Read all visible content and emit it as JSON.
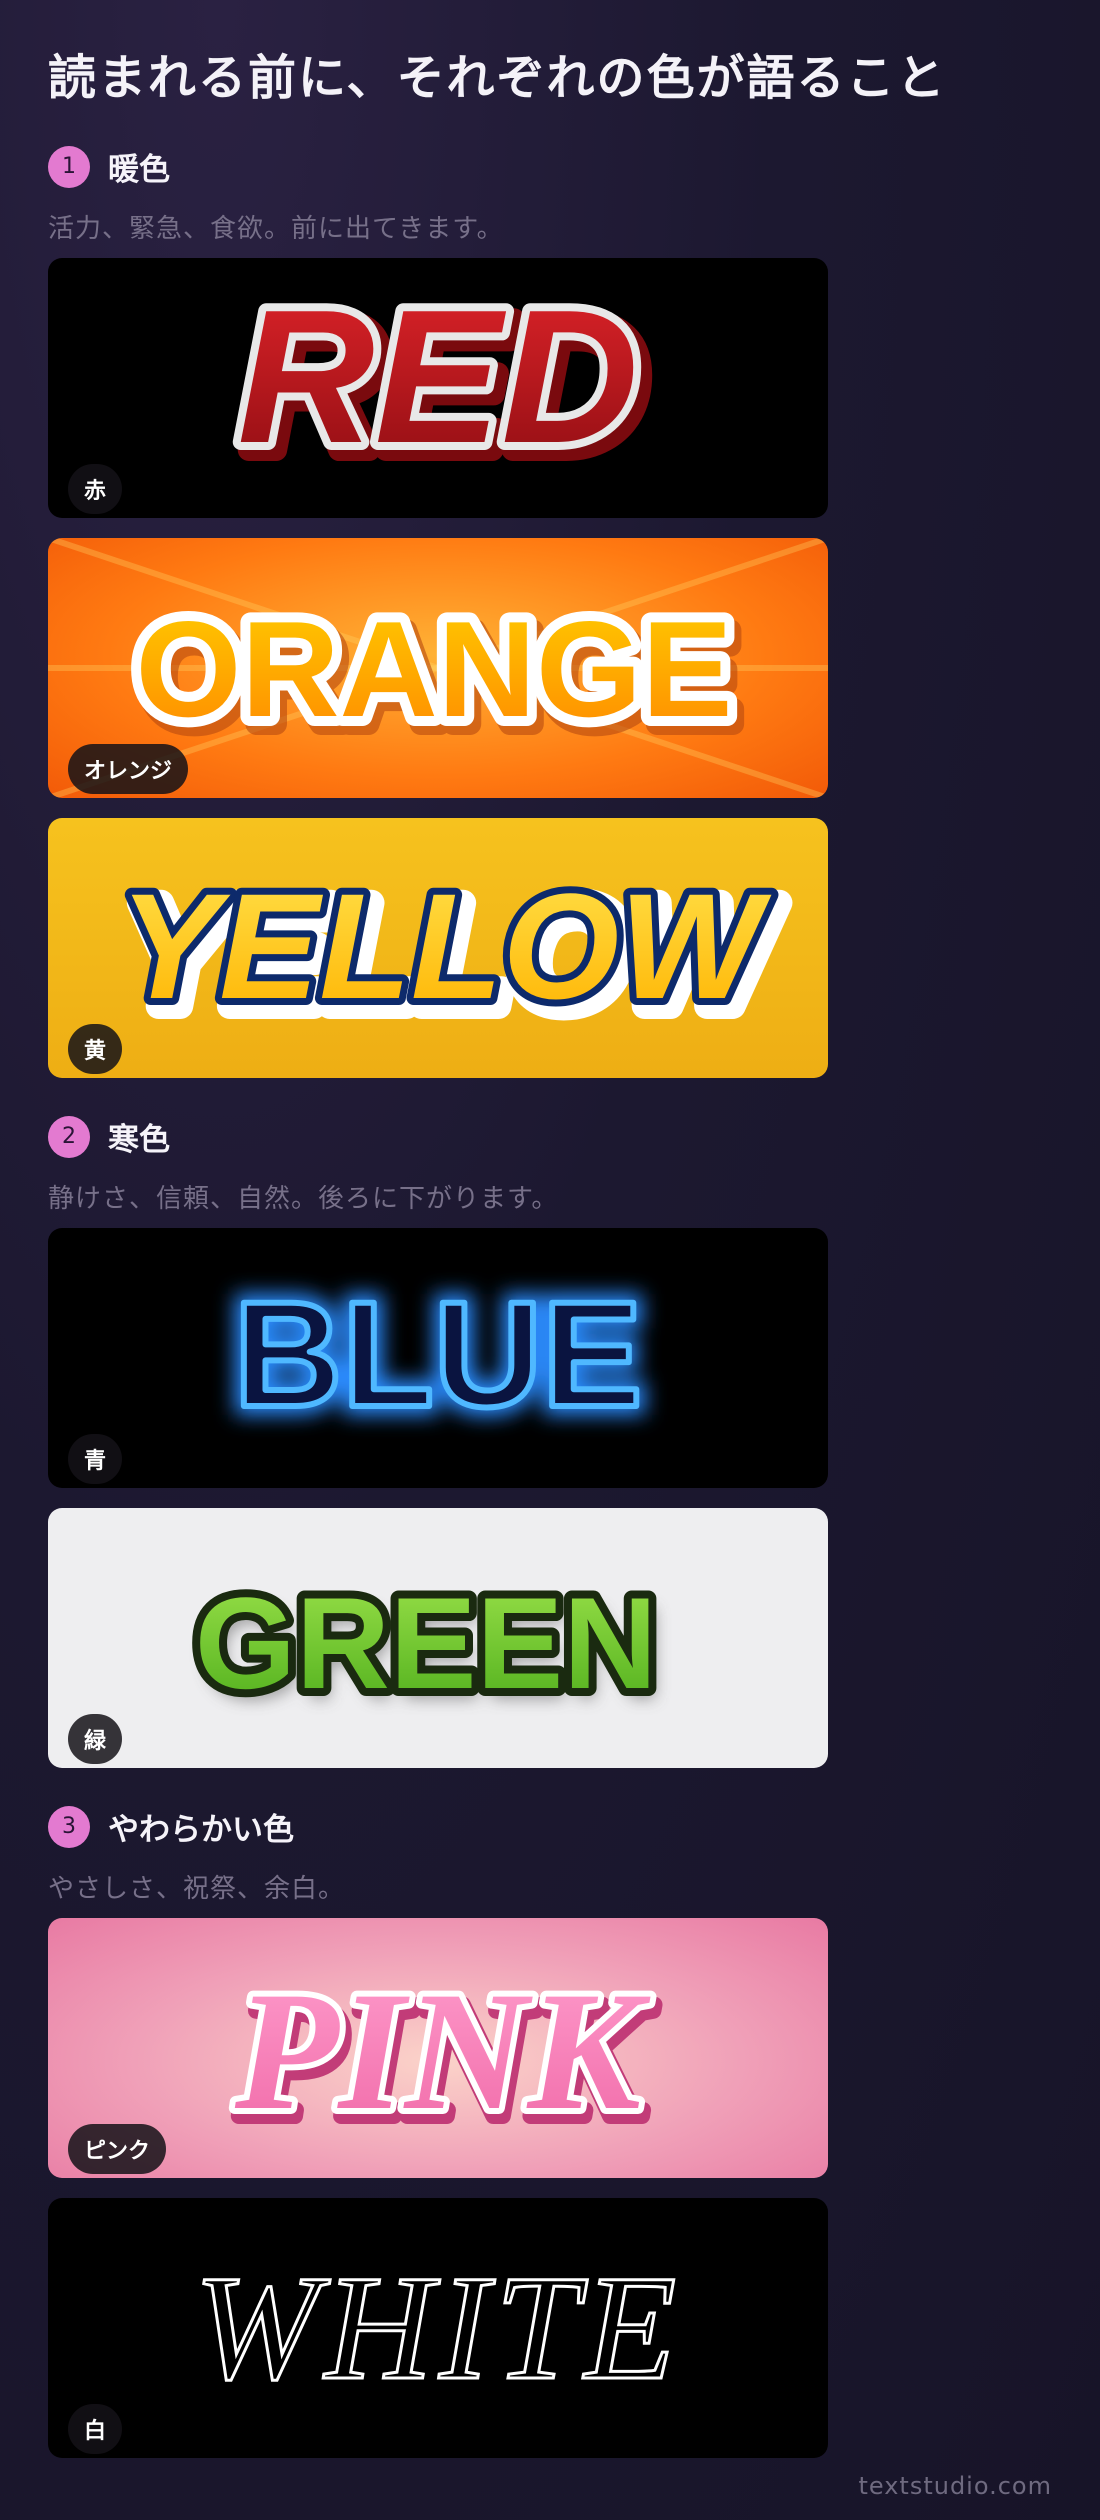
{
  "title": "読まれる前に、それぞれの色が語ること",
  "sections": [
    {
      "number": "1",
      "name": "暖色",
      "description": "活力、緊急、食欲。前に出てきます。",
      "cards": [
        {
          "word": "RED",
          "label": "赤",
          "background": "#000000",
          "fill": "#c0161c"
        },
        {
          "word": "ORANGE",
          "label": "オレンジ",
          "background": "#ff7a12",
          "fill": "#ffa400"
        },
        {
          "word": "YELLOW",
          "label": "黄",
          "background": "#f2b81a",
          "fill": "#ffd21a"
        }
      ]
    },
    {
      "number": "2",
      "name": "寒色",
      "description": "静けさ、信頼、自然。後ろに下がります。",
      "cards": [
        {
          "word": "BLUE",
          "label": "青",
          "background": "#000000",
          "fill": "#0a1440"
        },
        {
          "word": "GREEN",
          "label": "緑",
          "background": "#eeeef0",
          "fill": "#6fcf2a"
        }
      ]
    },
    {
      "number": "3",
      "name": "やわらかい色",
      "description": "やさしさ、祝祭、余白。",
      "cards": [
        {
          "word": "PINK",
          "label": "ピンク",
          "background": "#f0a0b8",
          "fill": "#f57fb5"
        },
        {
          "word": "WHITE",
          "label": "白",
          "background": "#000000",
          "fill": "#ffffff"
        }
      ]
    }
  ],
  "watermark": "textstudio.com"
}
